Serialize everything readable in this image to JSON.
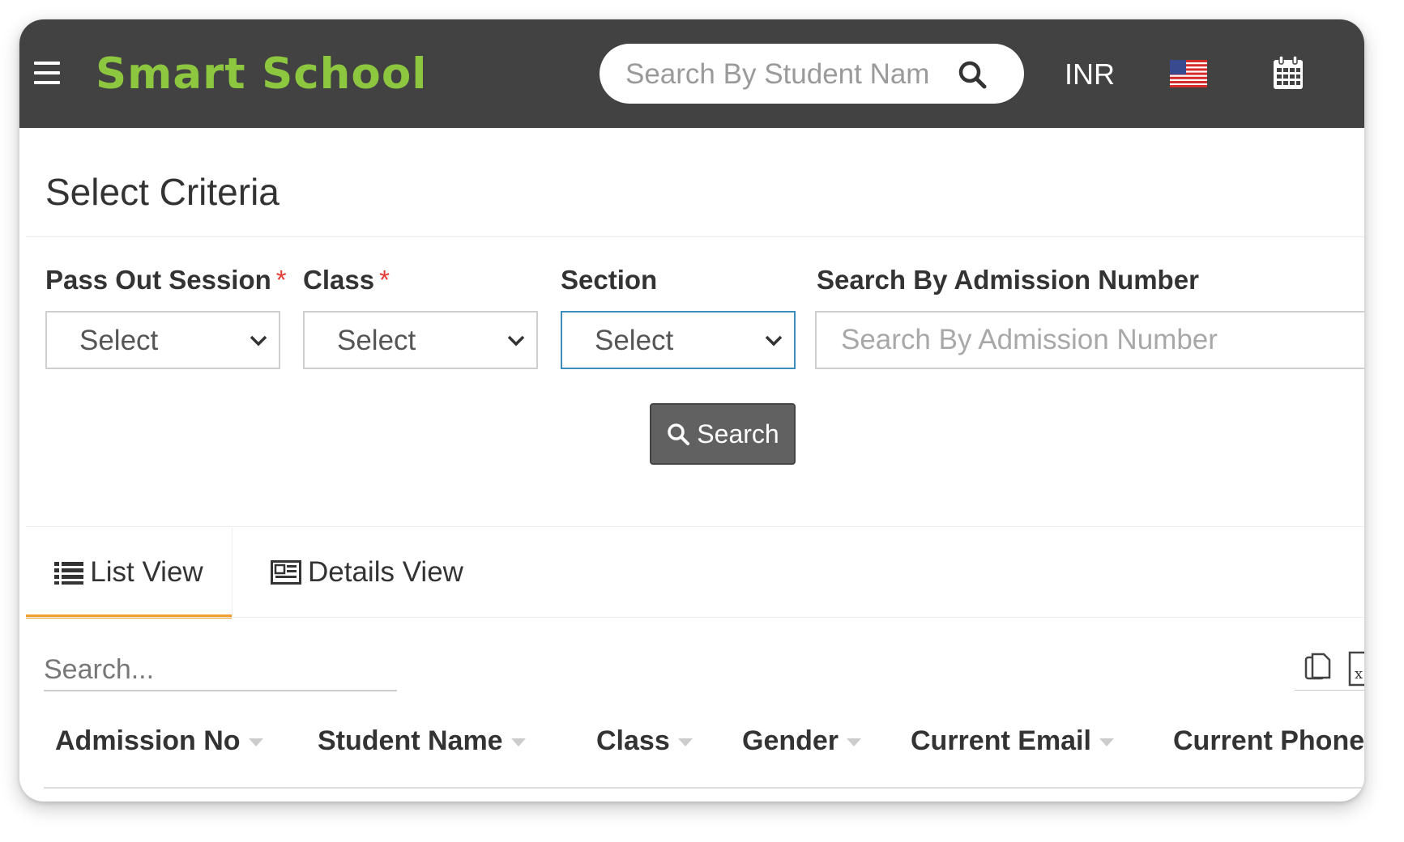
{
  "header": {
    "brand": "Smart School",
    "search_placeholder": "Search By Student Nam",
    "currency": "INR",
    "icons": [
      "menu-icon",
      "search-icon",
      "us-flag-icon",
      "calendar-icon"
    ]
  },
  "criteria": {
    "title": "Select Criteria",
    "fields": [
      {
        "label": "Pass Out Session",
        "required": "*",
        "value": "Select"
      },
      {
        "label": "Class",
        "required": "*",
        "value": "Select"
      },
      {
        "label": "Section",
        "value": "Select"
      }
    ],
    "admission": {
      "label": "Search By Admission Number",
      "placeholder": "Search By Admission Number"
    },
    "search_button": "Search"
  },
  "tabs": [
    {
      "label": "List View",
      "active": true
    },
    {
      "label": "Details View",
      "active": false
    }
  ],
  "table": {
    "search_placeholder": "Search...",
    "columns": [
      "Admission No",
      "Student Name",
      "Class",
      "Gender",
      "Current Email",
      "Current Phone"
    ]
  },
  "colors": {
    "header_bg": "#424242",
    "brand": "#8dc63f",
    "active_tab": "#f0a030",
    "required": "#e53935",
    "focus_border": "#3c8dbc"
  }
}
